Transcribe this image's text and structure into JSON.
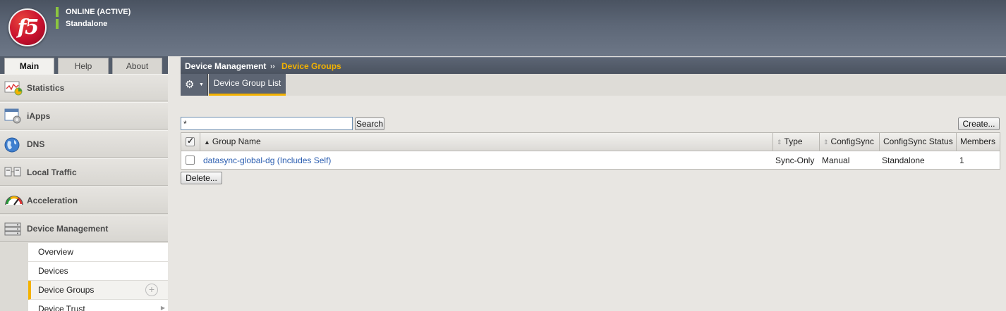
{
  "header": {
    "logo_text": "f5",
    "status": "ONLINE (ACTIVE)",
    "mode": "Standalone",
    "status_color": "#8cc63f"
  },
  "tabs": [
    {
      "label": "Main",
      "active": true
    },
    {
      "label": "Help",
      "active": false
    },
    {
      "label": "About",
      "active": false
    }
  ],
  "sidebar": {
    "items": [
      {
        "label": "Statistics",
        "icon": "statistics-icon"
      },
      {
        "label": "iApps",
        "icon": "iapps-icon"
      },
      {
        "label": "DNS",
        "icon": "globe-icon"
      },
      {
        "label": "Local Traffic",
        "icon": "local-traffic-icon"
      },
      {
        "label": "Acceleration",
        "icon": "gauge-icon"
      },
      {
        "label": "Device Management",
        "icon": "server-icon"
      }
    ],
    "subitems": [
      {
        "label": "Overview"
      },
      {
        "label": "Devices"
      },
      {
        "label": "Device Groups",
        "selected": true
      },
      {
        "label": "Device Trust"
      }
    ]
  },
  "breadcrumb": {
    "parent": "Device Management",
    "separator": "››",
    "current": "Device Groups",
    "current_color": "#f3b200"
  },
  "toolbar": {
    "gear_icon": "gear-icon",
    "tab_label": "Device Group List"
  },
  "search": {
    "value": "*",
    "button_label": "Search"
  },
  "actions": {
    "create_label": "Create...",
    "delete_label": "Delete..."
  },
  "table": {
    "columns": [
      "Group Name",
      "Type",
      "ConfigSync",
      "ConfigSync Status",
      "Members"
    ],
    "rows": [
      {
        "group_name": "datasync-global-dg (Includes Self)",
        "type": "Sync-Only",
        "configsync": "Manual",
        "configsync_status": "Standalone",
        "members": "1"
      }
    ]
  }
}
